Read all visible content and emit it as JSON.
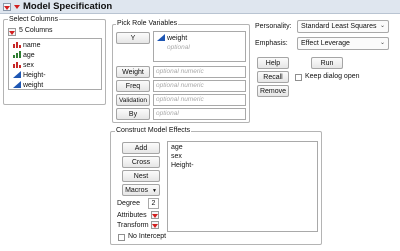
{
  "title": "Model Specification",
  "select_columns": {
    "label": "Select Columns",
    "count_label": "5 Columns",
    "columns": [
      {
        "name": "name",
        "icon": "nominal-icon"
      },
      {
        "name": "age",
        "icon": "ordinal-icon"
      },
      {
        "name": "sex",
        "icon": "nominal-icon"
      },
      {
        "name": "Height-",
        "icon": "continuous-icon"
      },
      {
        "name": "weight",
        "icon": "continuous-icon"
      }
    ]
  },
  "pick_role": {
    "label": "Pick Role Variables",
    "y_button": "Y",
    "y_value": "weight",
    "y_placeholder": "optional",
    "roles": [
      {
        "button": "Weight",
        "placeholder": "optional numeric"
      },
      {
        "button": "Freq",
        "placeholder": "optional numeric"
      },
      {
        "button": "Validation",
        "placeholder": "optional numeric"
      },
      {
        "button": "By",
        "placeholder": "optional"
      }
    ]
  },
  "personality": {
    "label": "Personality:",
    "value": "Standard Least Squares"
  },
  "emphasis": {
    "label": "Emphasis:",
    "value": "Effect Leverage"
  },
  "actions": {
    "help": "Help",
    "run": "Run",
    "recall": "Recall",
    "keep_open": "Keep dialog open",
    "remove": "Remove"
  },
  "construct": {
    "label": "Construct Model Effects",
    "add": "Add",
    "cross": "Cross",
    "nest": "Nest",
    "macros": "Macros",
    "degree_label": "Degree",
    "degree_value": "2",
    "attributes": "Attributes",
    "transform": "Transform",
    "no_intercept": "No Intercept",
    "effects": [
      "age",
      "sex",
      "Height-"
    ]
  },
  "colors": {
    "red_triangle": "#d21f1f",
    "nominal_red": "#c62828",
    "ordinal_green": "#2e7d32",
    "continuous_blue": "#1e56b3",
    "titlebar_bg": "#dfe6ef"
  }
}
